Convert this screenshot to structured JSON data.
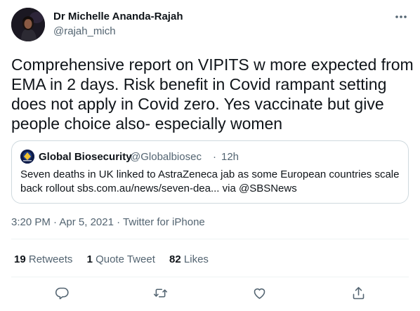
{
  "author": {
    "name": "Dr Michelle Ananda-Rajah",
    "handle": "@rajah_mich"
  },
  "tweet_text": "Comprehensive report on VIPITS w more expected from EMA in 2 days. Risk benefit in Covid rampant setting does not apply in Covid zero. Yes vaccinate but give people choice also- especially women",
  "quoted": {
    "name": "Global Biosecurity",
    "handle": "@Globalbiosec",
    "separator": "·",
    "time": "12h",
    "text": "Seven deaths in UK linked to AstraZeneca jab as some European countries scale back rollout sbs.com.au/news/seven-dea... via @SBSNews"
  },
  "meta": {
    "time": "3:20 PM",
    "separator": "·",
    "date": "Apr 5, 2021",
    "source": "Twitter for iPhone"
  },
  "stats": {
    "retweets_count": "19",
    "retweets_label": "Retweets",
    "quotes_count": "1",
    "quotes_label": "Quote Tweet",
    "likes_count": "82",
    "likes_label": "Likes"
  },
  "actions": {
    "reply_icon": "reply-icon",
    "retweet_icon": "retweet-icon",
    "like_icon": "heart-icon",
    "share_icon": "share-icon"
  },
  "colors": {
    "text": "#0f1419",
    "secondary": "#536471",
    "border": "#cfd9de",
    "divider": "#eff3f4"
  }
}
